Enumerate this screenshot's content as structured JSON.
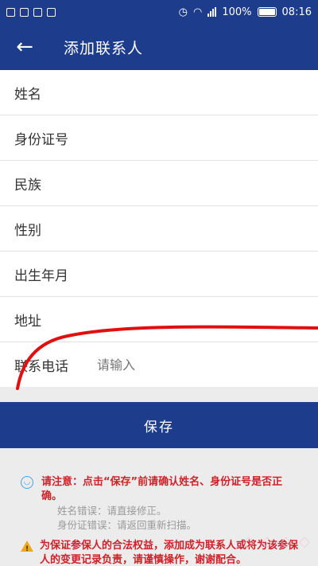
{
  "status_bar": {
    "battery": "100%",
    "time": "08:16"
  },
  "app_bar": {
    "back_icon": "←",
    "title": "添加联系人"
  },
  "form": {
    "fields": [
      {
        "label": "姓名"
      },
      {
        "label": "身份证号"
      },
      {
        "label": "民族"
      },
      {
        "label": "性别"
      },
      {
        "label": "出生年月"
      },
      {
        "label": "地址"
      },
      {
        "label": "联系电话",
        "placeholder": "请输入"
      }
    ]
  },
  "save_button": "保存",
  "notice": {
    "line1": "请注意：点击“保存”前请确认姓名、身份证号是否正确。",
    "line2": "姓名错误：请直接修正。",
    "line3": "身份证错误：请返回重新扫描。",
    "line4": "为保证参保人的合法权益，添加成为联系人或将为该参保人的变更记录负责，请谨慎操作，谢谢配合。"
  },
  "colors": {
    "primary": "#1e3c8c",
    "warning_text": "#d0202a",
    "annotation": "#e01010"
  }
}
